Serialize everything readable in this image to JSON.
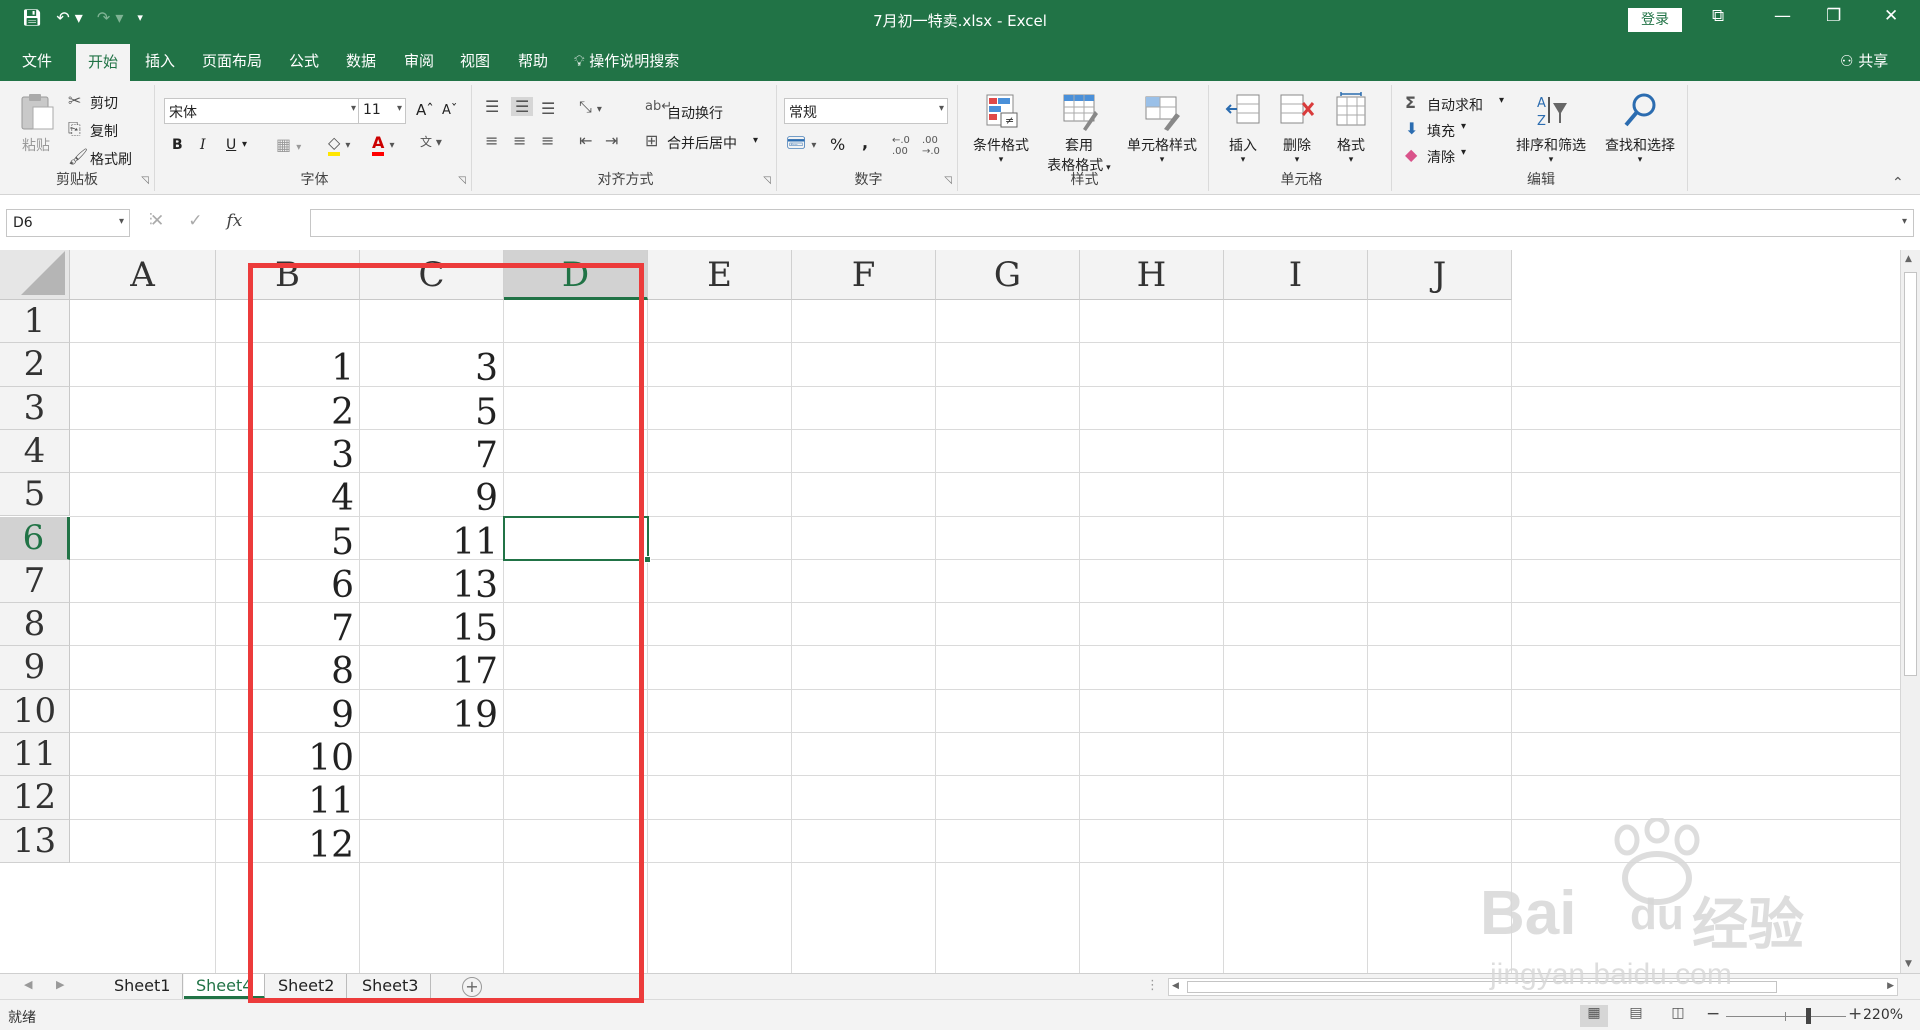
{
  "window": {
    "title": "7月初一特卖.xlsx  -  Excel",
    "login": "登录"
  },
  "tabs": [
    "文件",
    "开始",
    "插入",
    "页面布局",
    "公式",
    "数据",
    "审阅",
    "视图",
    "帮助"
  ],
  "active_tab": "开始",
  "tellme": "操作说明搜索",
  "share": "共享",
  "ribbon": {
    "clipboard": {
      "label": "剪贴板",
      "paste": "粘贴",
      "cut": "剪切",
      "copy": "复制",
      "format_painter": "格式刷"
    },
    "font": {
      "label": "字体",
      "font_name": "宋体",
      "font_size": "11",
      "bold": "B",
      "italic": "I",
      "underline": "U"
    },
    "alignment": {
      "label": "对齐方式",
      "wrap_text": "自动换行",
      "merge_center": "合并后居中"
    },
    "number": {
      "label": "数字",
      "format": "常规",
      "percent": "%",
      "comma": ","
    },
    "styles": {
      "label": "样式",
      "conditional": "条件格式",
      "table_format_1": "套用",
      "table_format_2": "表格格式",
      "cell_styles": "单元格样式"
    },
    "cells": {
      "label": "单元格",
      "insert": "插入",
      "delete": "删除",
      "format": "格式"
    },
    "editing": {
      "label": "编辑",
      "autosum": "自动求和",
      "fill": "填充",
      "clear": "清除",
      "sort_filter": "排序和筛选",
      "find_select": "查找和选择"
    }
  },
  "formula_bar": {
    "name_box": "D6",
    "formula": "",
    "fx": "fx"
  },
  "columns": [
    "A",
    "B",
    "C",
    "D",
    "E",
    "F",
    "G",
    "H",
    "I",
    "J"
  ],
  "rows": [
    "1",
    "2",
    "3",
    "4",
    "5",
    "6",
    "7",
    "8",
    "9",
    "10",
    "11",
    "12",
    "13"
  ],
  "selected_column": "D",
  "selected_row": "6",
  "cells": {
    "B": [
      "",
      "1",
      "2",
      "3",
      "4",
      "5",
      "6",
      "7",
      "8",
      "9",
      "10",
      "11",
      "12"
    ],
    "C": [
      "",
      "3",
      "5",
      "7",
      "9",
      "11",
      "13",
      "15",
      "17",
      "19",
      "",
      "",
      ""
    ]
  },
  "sheets": [
    "Sheet1",
    "Sheet4",
    "Sheet2",
    "Sheet3"
  ],
  "active_sheet": "Sheet4",
  "status": {
    "ready": "就绪",
    "zoom": "220%"
  },
  "watermark": {
    "brand": "Bai",
    "brand2": "du",
    "cn": "经验",
    "url": "jingyan.baidu.com"
  },
  "colors": {
    "excel_green": "#217346",
    "highlight_red": "#ec3b3b",
    "ribbon_bg": "#f3f3f3"
  }
}
